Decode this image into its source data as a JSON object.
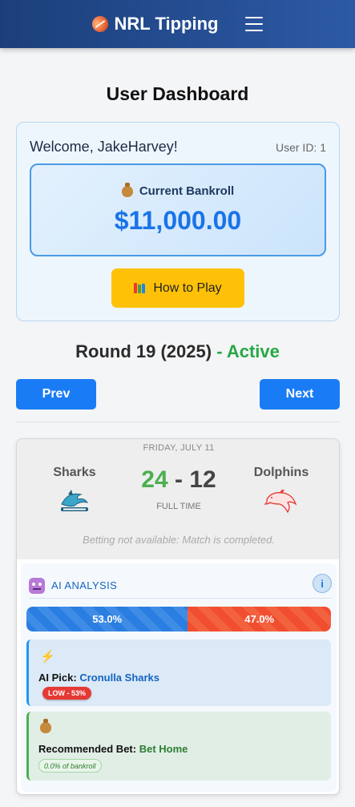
{
  "header": {
    "brand_icon": "rugby-ball-icon",
    "title": "NRL Tipping",
    "menu_icon": "hamburger-menu-icon"
  },
  "page": {
    "title": "User Dashboard"
  },
  "welcome": {
    "greeting": "Welcome, JakeHarvey!",
    "user_id": "User ID: 1",
    "bankroll_label": "Current Bankroll",
    "bankroll_value": "$11,000.00",
    "how_to_play": "How to Play"
  },
  "round": {
    "title": "Round 19 (2025)",
    "status": "- Active",
    "status_color": "#28a745",
    "prev_label": "Prev",
    "next_label": "Next"
  },
  "match": {
    "date": "FRIDAY, JULY 11",
    "home_team": "Sharks",
    "away_team": "Dolphins",
    "home_score": "24",
    "separator": "-",
    "away_score": "12",
    "status": "FULL TIME",
    "betting_note": "Betting not available: Match is completed."
  },
  "ai": {
    "title": "AI ANALYSIS",
    "info_symbol": "i",
    "home_prob": 53.0,
    "away_prob": 47.0,
    "home_prob_label": "53.0%",
    "away_prob_label": "47.0%",
    "pick_prefix": "AI Pick:",
    "pick_team": "Cronulla Sharks",
    "confidence": "LOW - 53%",
    "bet_prefix": "Recommended Bet:",
    "bet_value": "Bet Home",
    "bet_pct": "0.0% of bankroll"
  }
}
